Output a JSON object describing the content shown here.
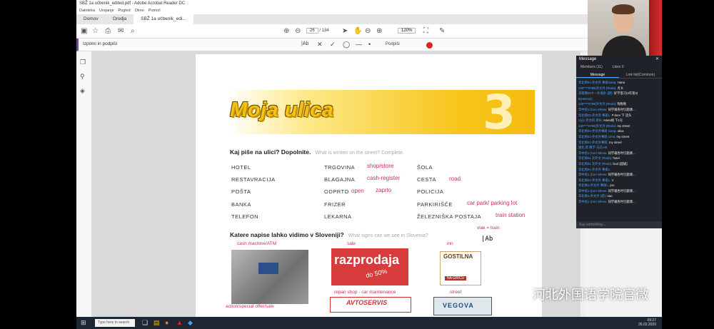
{
  "window": {
    "title": "SBŽ 1a učbenik_edited.pdf - Adobe Acrobat Reader DC",
    "menu": [
      "Datoteka",
      "Urejanje",
      "Pogled",
      "Okno",
      "Pomoč"
    ]
  },
  "tabs": [
    {
      "label": "Domov"
    },
    {
      "label": "Orodja"
    },
    {
      "label": "SBŽ 1a učbenik_edi..."
    }
  ],
  "toolbar": {
    "current_page": "26",
    "total_pages": "/ 134",
    "zoom": "120%"
  },
  "signbar": {
    "label": "Izpolni in podpiši",
    "text_tool": "|Ab",
    "cross": "✕",
    "check": "✓",
    "sign_label": "Podpiši"
  },
  "page": {
    "title": "Moja ulica",
    "chapter": "3",
    "q1": "Kaj piše na ulici? Dopolnite.",
    "q1_en": "What is written on the street? Complete.",
    "col1": [
      "HOTEL",
      "RESTAVRACIJA",
      "POŠTA",
      "BANKA",
      "TELEFON"
    ],
    "col2": [
      "TRGOVINA",
      "BLAGAJNA",
      "ODPRTO",
      "FRIZER",
      "LEKARNA"
    ],
    "col3": [
      "ŠOLA",
      "CESTA",
      "POLICIJA",
      "PARKIRIŠČE",
      "ŽELEZNIŠKA POSTAJA"
    ],
    "notes": {
      "shop": "shop/store",
      "cash": "cash-register",
      "road": "road",
      "open": "open",
      "zaprto": "zaprto",
      "carpark": "car park/ parking lot",
      "train_station": "train station",
      "vlak": "vlak = train",
      "cash_machine": "cash machine/ATM",
      "sale": "sale",
      "inn": "inn",
      "repair": "repair shop - car maintenance",
      "street": "street",
      "action": "action/special offer/sale"
    },
    "q2": "Katere napise lahko vidimo v Sloveniji?",
    "q2_en": "What signs can we see in Slovenia?",
    "sale_sign": "razprodaja",
    "sale_sub": "do 50%",
    "avto_sign": "AVTOSERVIS",
    "gostilna_top": "GOSTILNA",
    "gostilna_bottom": "NA GRICU",
    "vegova": "VEGOVA",
    "cursor": "|Ab"
  },
  "messages": {
    "title": "Message",
    "members": "Members (11)",
    "likes": "Likes 0",
    "tab_message": "Message",
    "tab_list": "Link list(Common)",
    "lines": [
      {
        "who": "华北倚01-外文外 事班Gang:",
        "txt": "Hana"
      },
      {
        "who": "130****0766(外文外 (Reda):",
        "txt": "点 ft."
      },
      {
        "who": "华南佛03 ft ~ 外语外 (教):",
        "txt": "好学温习(4年第3)"
      },
      {
        "who": "5(Helena):",
        "txt": ""
      },
      {
        "who": "130****0766(外文外 (Reda):",
        "txt": "啦啦啦"
      },
      {
        "who": "华中倍1 (Ceri Shrew:",
        "txt": "同学邀各时引题课..."
      },
      {
        "who": "华北倚01-外文外 事班L:",
        "txt": "P door 下 流头"
      },
      {
        "who": "1分1 外文的 班长:",
        "txt": "Hana线 下1号"
      },
      {
        "who": "130****0766(外文外 (Reda):",
        "txt": "my street"
      },
      {
        "who": "华北倚01-外文外事班 Gang:",
        "txt": "ulica"
      },
      {
        "who": "华北倚01-外文外事班 Lima:",
        "txt": "my street"
      },
      {
        "who": "华北倚01-外文外事班:",
        "txt": "my street"
      },
      {
        "who": "湖北 的 教学 方向 Ab:",
        "txt": ""
      },
      {
        "who": "华中倍1 (Ceri Shrew:",
        "txt": "同学邀各时引题课..."
      },
      {
        "who": "华北倚01 次外文 (Reda):",
        "txt": "hotel"
      },
      {
        "who": "华北倚01 次外文 (Reda):",
        "txt": "bcol [超级]"
      },
      {
        "who": "华北倚01-外文外 事班L:",
        "txt": ""
      },
      {
        "who": "华中倍1 (Ceri Shrew:",
        "txt": "同学邀各时引题课..."
      },
      {
        "who": "华北倚01-外文外 事班L:",
        "txt": "V"
      },
      {
        "who": "华北倚1-外文外 事班L:",
        "txt": "pro"
      },
      {
        "who": "华中倍1 (Ceri Shrew:",
        "txt": "同学邀各时引题课..."
      },
      {
        "who": "华北倚1-外文外 (班):",
        "txt": "nao"
      },
      {
        "who": "华中倍1 (Ceri Shrew:",
        "txt": "同学邀各时引题课..."
      }
    ],
    "input_placeholder": "Say something..."
  },
  "taskbar": {
    "search": "Type here to search",
    "time": "09:27",
    "date": "26.02.2020"
  },
  "watermark": "河北外国语学院官微"
}
